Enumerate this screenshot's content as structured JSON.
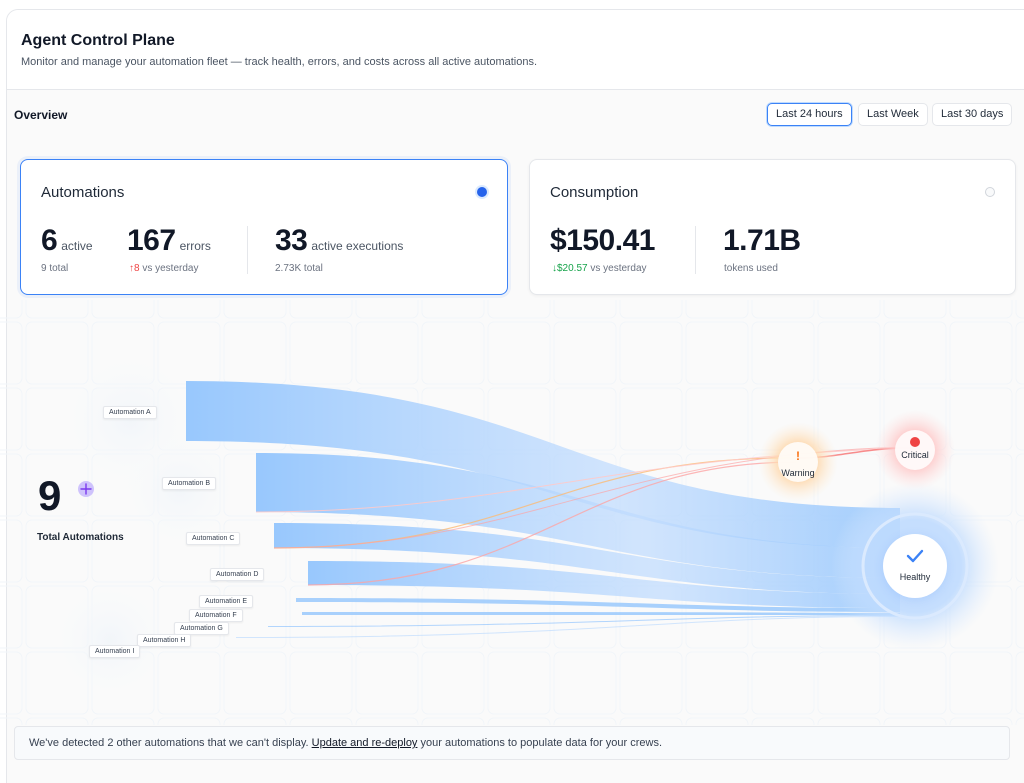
{
  "header": {
    "title": "Agent Control Plane",
    "subtitle": "Monitor and manage your automation fleet — track health, errors, and costs across all active automations."
  },
  "overview": {
    "label": "Overview",
    "ranges": [
      "Last 24 hours",
      "Last Week",
      "Last 30 days"
    ],
    "selected_range": "Last 24 hours"
  },
  "automations_card": {
    "title": "Automations",
    "selected": true,
    "active_value": "6",
    "active_unit": "active",
    "total": "9 total",
    "errors_value": "167",
    "errors_unit": "errors",
    "errors_delta": "↑8",
    "errors_delta_suffix": "vs yesterday",
    "exec_value": "33",
    "exec_unit": "active executions",
    "exec_total": "2.73K total"
  },
  "consumption_card": {
    "title": "Consumption",
    "selected": false,
    "cost_value": "$150.41",
    "cost_delta": "↓$20.57",
    "cost_delta_suffix": "vs yesterday",
    "tokens_value": "1.71B",
    "tokens_unit": "tokens used"
  },
  "flow": {
    "total_count": "9",
    "total_label": "Total Automations",
    "automations": [
      "Automation A",
      "Automation B",
      "Automation C",
      "Automation D",
      "Automation E",
      "Automation F",
      "Automation G",
      "Automation H",
      "Automation I"
    ],
    "statuses": {
      "warning": "Warning",
      "critical": "Critical",
      "healthy": "Healthy"
    },
    "colors": {
      "healthy": "#93c5fd",
      "warning": "#fdba74",
      "critical": "#f87171",
      "accent": "#3b82f6"
    }
  },
  "banner": {
    "prefix": "We've detected 2 other automations that we can't display.",
    "link": "Update and re-deploy",
    "suffix": "your automations to populate data for your crews."
  }
}
